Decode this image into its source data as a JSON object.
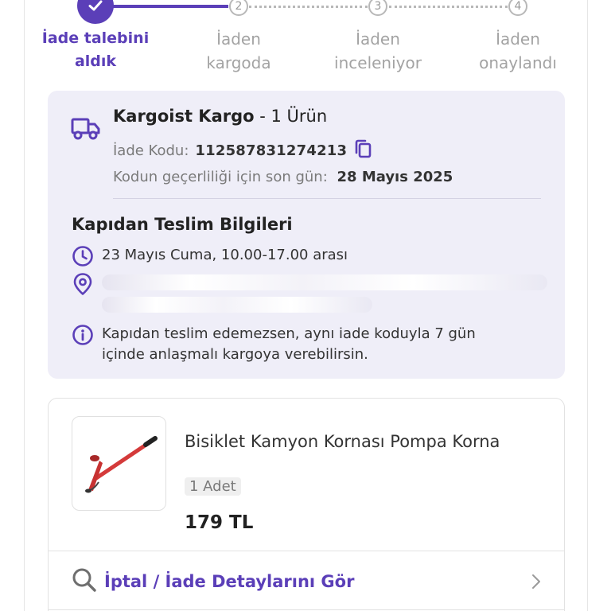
{
  "stepper": {
    "steps": [
      {
        "label_line1": "İade talebini",
        "label_line2": "aldık",
        "status": "done"
      },
      {
        "number": "2",
        "label_line1": "İaden",
        "label_line2": "kargoda",
        "status": "todo"
      },
      {
        "number": "3",
        "label_line1": "İaden",
        "label_line2": "inceleniyor",
        "status": "todo"
      },
      {
        "number": "4",
        "label_line1": "İaden",
        "label_line2": "onaylandı",
        "status": "todo"
      }
    ],
    "accent_color": "#5b3fb8"
  },
  "shipment": {
    "carrier_name": "Kargoist Kargo",
    "carrier_suffix": " - 1 Ürün",
    "return_code_label": "İade Kodu:",
    "return_code": "112587831274213",
    "expiry_label": "Kodun geçerliliği için son gün:",
    "expiry_date": "28 Mayıs 2025",
    "icons": {
      "carrier": "truck-icon",
      "copy": "copy-icon"
    }
  },
  "delivery": {
    "title": "Kapıdan Teslim Bilgileri",
    "time_window": "23 Mayıs Cuma, 10.00-17.00 arası",
    "info_text_line1": "Kapıdan teslim edemezsen, aynı iade koduyla 7 gün",
    "info_text_line2": "içinde anlaşmalı kargoya verebilirsin.",
    "icons": {
      "time": "clock-icon",
      "address": "location-pin-icon",
      "info": "info-icon"
    }
  },
  "product": {
    "name": "Bisiklet Kamyon Kornası Pompa Korna",
    "quantity": "1 Adet",
    "price": "179 TL"
  },
  "actions": {
    "details_link": "İptal / İade Detaylarını Gör",
    "icons": {
      "details": "search-icon",
      "chevron": "chevron-right-icon"
    }
  }
}
